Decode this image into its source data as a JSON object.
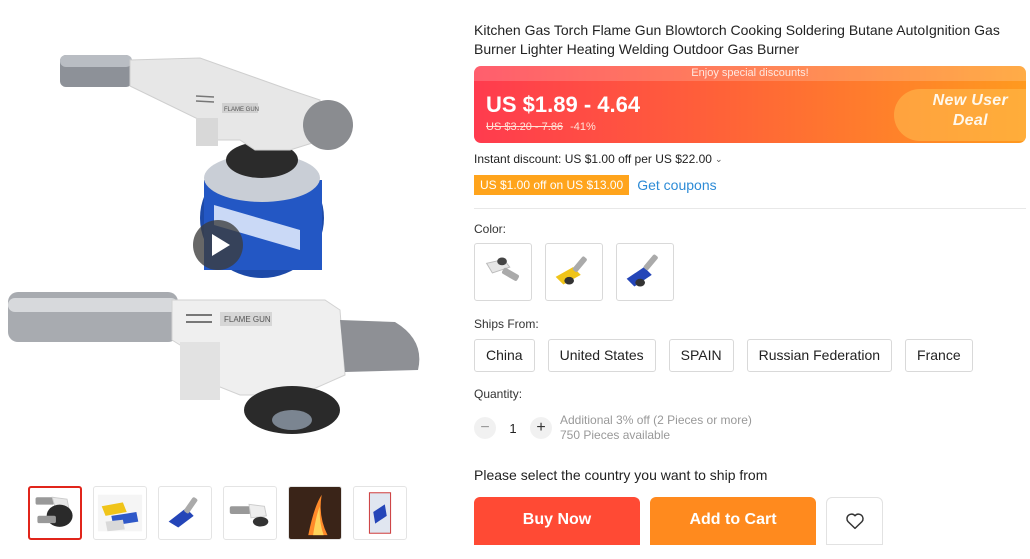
{
  "product": {
    "title": "Kitchen Gas Torch Flame Gun Blowtorch Cooking Soldering Butane AutoIgnition Gas Burner Lighter Heating Welding Outdoor Gas Burner",
    "gallery_text": "FLAME GUN",
    "thumbnails": [
      "thumb-white-torch",
      "thumb-yellow-set",
      "thumb-blue-torch",
      "thumb-white-torch-side",
      "thumb-flame-photo",
      "thumb-packaged"
    ]
  },
  "banner": {
    "top_text": "Enjoy special discounts!",
    "price": "US $1.89 - 4.64",
    "original_price": "US $3.20 - 7.86",
    "discount": "-41%",
    "badge_line1": "New User",
    "badge_line2": "Deal"
  },
  "promo": {
    "instant_discount": "Instant discount: US $1.00 off per US $22.00",
    "coupon_tag": "US $1.00 off on US $13.00",
    "get_coupons": "Get coupons"
  },
  "color": {
    "label": "Color:",
    "options": [
      "white",
      "yellow",
      "blue"
    ]
  },
  "ships": {
    "label": "Ships From:",
    "options": [
      "China",
      "United States",
      "SPAIN",
      "Russian Federation",
      "France"
    ]
  },
  "quantity": {
    "label": "Quantity:",
    "minus": "−",
    "value": "1",
    "plus": "+",
    "info_line1": "Additional 3% off (2 Pieces or more)",
    "info_line2": "750 Pieces available"
  },
  "shipping_message": "Please select the country you want to ship from",
  "actions": {
    "buy_now": "Buy Now",
    "add_to_cart": "Add to Cart",
    "wishlist_icon": "heart-icon"
  },
  "colors": {
    "price_banner_start": "#ff3b4e",
    "price_banner_end": "#ff9a1f",
    "buy_now": "#ff4a34",
    "add_to_cart": "#ff8a1e",
    "coupon_tag": "#ffa41c",
    "link": "#2d8bd6",
    "active_thumb_border": "#e1251b"
  }
}
